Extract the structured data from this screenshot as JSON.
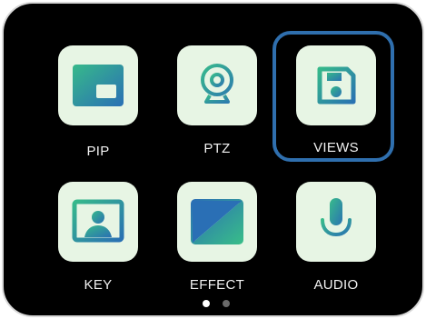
{
  "menu": {
    "items": [
      {
        "label": "PIP",
        "icon": "pip-icon",
        "selected": false
      },
      {
        "label": "PTZ",
        "icon": "webcam-icon",
        "selected": false
      },
      {
        "label": "VIEWS",
        "icon": "floppy-disk-icon",
        "selected": true
      },
      {
        "label": "KEY",
        "icon": "portrait-icon",
        "selected": false
      },
      {
        "label": "EFFECT",
        "icon": "diagonal-wipe-icon",
        "selected": false
      },
      {
        "label": "AUDIO",
        "icon": "microphone-icon",
        "selected": false
      }
    ]
  },
  "pagination": {
    "total_pages": 2,
    "current_page": 1
  },
  "colors": {
    "background": "#000000",
    "tile": "#e7f5e4",
    "icon_green": "#2fb48a",
    "icon_blue": "#2a6fb5",
    "selection": "#2f6fae",
    "label": "#f2f2f2",
    "dot_active": "#ffffff",
    "dot_inactive": "#6a6a6a"
  }
}
